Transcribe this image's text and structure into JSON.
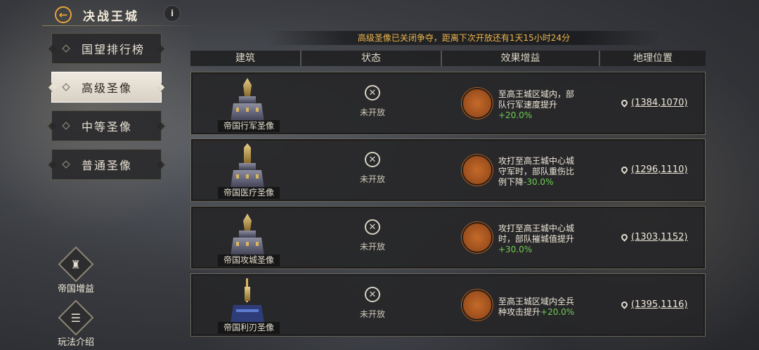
{
  "header": {
    "title": "决战王城",
    "info_label": "i"
  },
  "tabs": [
    {
      "label": "国望排行榜",
      "active": false
    },
    {
      "label": "高级圣像",
      "active": true
    },
    {
      "label": "中等圣像",
      "active": false
    },
    {
      "label": "普通圣像",
      "active": false
    }
  ],
  "side_buttons": [
    {
      "label": "帝国增益",
      "icon": "castle-icon"
    },
    {
      "label": "玩法介绍",
      "icon": "book-icon"
    }
  ],
  "banner": "高级圣像已关闭争夺，距离下次开放还有1天15小时24分",
  "table": {
    "headers": [
      "建筑",
      "状态",
      "效果增益",
      "地理位置"
    ],
    "rows": [
      {
        "name": "帝国行军圣像",
        "status": "未开放",
        "effect_line1": "至高王城区域内，部",
        "effect_line2": "队行军速度提升",
        "effect_line3_prefix": "",
        "effect_value": "+20.0%",
        "coord": "(1384,1070)",
        "effect_icon": "boot-icon"
      },
      {
        "name": "帝国医疗圣像",
        "status": "未开放",
        "effect_line1": "攻打至高王城中心城",
        "effect_line2": "守军时，部队重伤比",
        "effect_line3_prefix": "例下降",
        "effect_value": "-30.0%",
        "coord": "(1296,1110)",
        "effect_icon": "soldier-icon"
      },
      {
        "name": "帝国攻城圣像",
        "status": "未开放",
        "effect_line1": "攻打至高王城中心城",
        "effect_line2": "时，部队摧城值提升",
        "effect_line3_prefix": "",
        "effect_value": "+30.0%",
        "coord": "(1303,1152)",
        "effect_icon": "siege-icon"
      },
      {
        "name": "帝国利刃圣像",
        "status": "未开放",
        "effect_line1": "至高王城区域内全兵",
        "effect_line2": "种攻击提升",
        "effect_line3_prefix": "",
        "effect_value": "+20.0%",
        "coord": "(1395,1116)",
        "effect_icon": "sword-icon"
      }
    ]
  },
  "colors": {
    "accent": "#efb54a",
    "positive": "#6fce52",
    "effect_icon": "#c46a2a"
  }
}
